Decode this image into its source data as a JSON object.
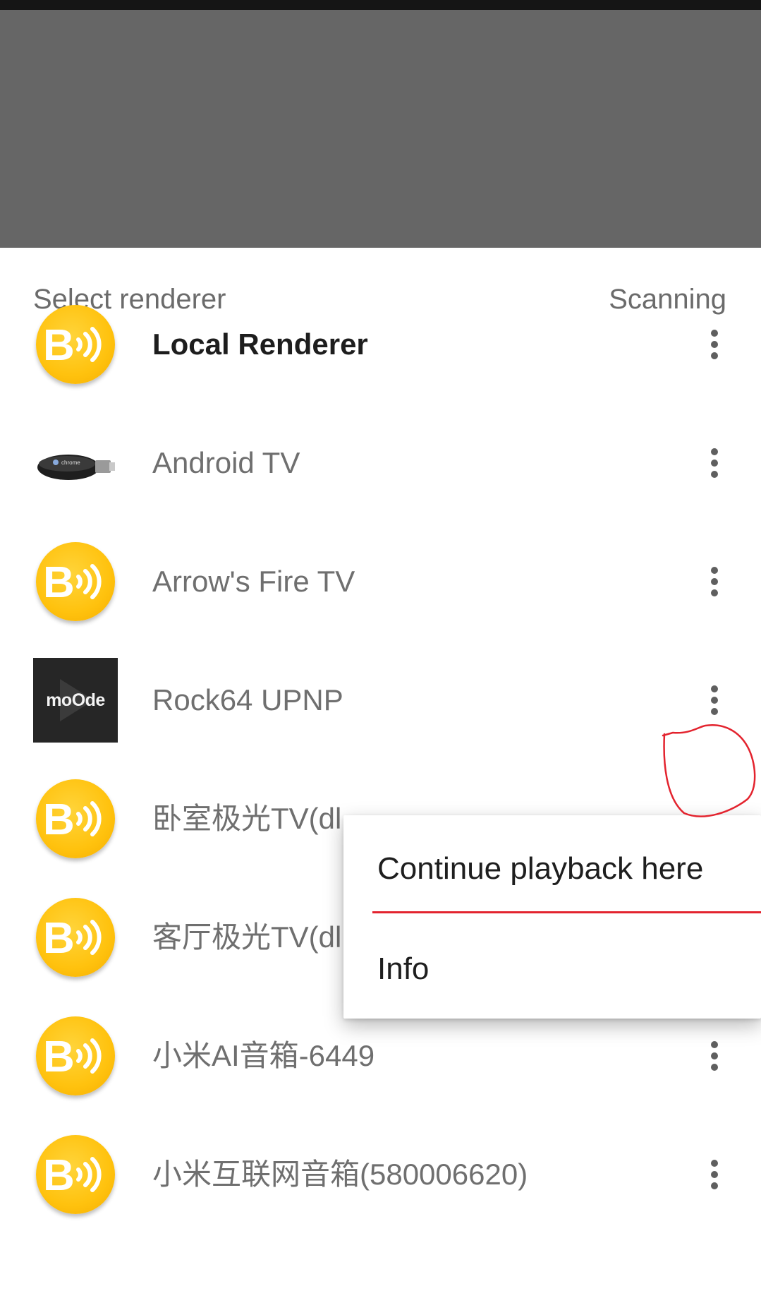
{
  "header": {
    "title": "Select renderer",
    "status": "Scanning"
  },
  "renderers": [
    {
      "name": "Local Renderer",
      "icon": "bubbleupnp-icon"
    },
    {
      "name": "Android TV",
      "icon": "chromecast-icon"
    },
    {
      "name": "Arrow's Fire TV",
      "icon": "bubbleupnp-icon"
    },
    {
      "name": "Rock64 UPNP",
      "icon": "moode-icon"
    },
    {
      "name": "卧室极光TV(dl",
      "icon": "bubbleupnp-icon"
    },
    {
      "name": "客厅极光TV(dl",
      "icon": "bubbleupnp-icon"
    },
    {
      "name": "小米AI音箱-6449",
      "icon": "bubbleupnp-icon"
    },
    {
      "name": "小米互联网音箱(580006620)",
      "icon": "bubbleupnp-icon"
    }
  ],
  "context_menu": {
    "items": [
      "Continue playback here",
      "Info"
    ]
  },
  "icons": {
    "bubble_letter": "B",
    "chromecast_text": "chrome",
    "moode_text": "moOde"
  },
  "colors": {
    "accent_yellow": "#FFC20E",
    "scrim": "#666666",
    "annotation_red": "#E3232E"
  }
}
